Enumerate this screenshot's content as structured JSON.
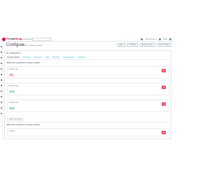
{
  "header": {
    "logo_main": "Presta",
    "logo_accent": "Shop",
    "quick_access": "Quick access",
    "search_icon": "search-icon",
    "right_items": [
      "Maintenance",
      "Visit",
      "Account"
    ]
  },
  "page": {
    "title": "Configure",
    "breadcrumb": "Modules / Module manager",
    "toolbar": [
      "Back",
      "Translate",
      "Manage hooks",
      "Check update"
    ]
  },
  "config": {
    "heading": "Configuration",
    "tabs": [
      "General settings",
      "Products",
      "Categories",
      "CMS",
      "Suppliers",
      "Manufacturers",
      "Attributes"
    ],
    "section1_title": "Block the products for these profiles",
    "rows": [
      {
        "label": "Product title",
        "tag": "Title",
        "tag_color": "red"
      },
      {
        "label": "Product title",
        "tag": "Show",
        "tag_color": "green"
      },
      {
        "label": "Product title",
        "tag": "Show",
        "tag_color": "green"
      }
    ],
    "add_link": "Add a new block",
    "section2_title": "Block the products for these brands",
    "row4_label": "Product"
  },
  "colors": {
    "accent": "#e0004d",
    "link": "#25b9d7",
    "danger": "#e0495f"
  }
}
